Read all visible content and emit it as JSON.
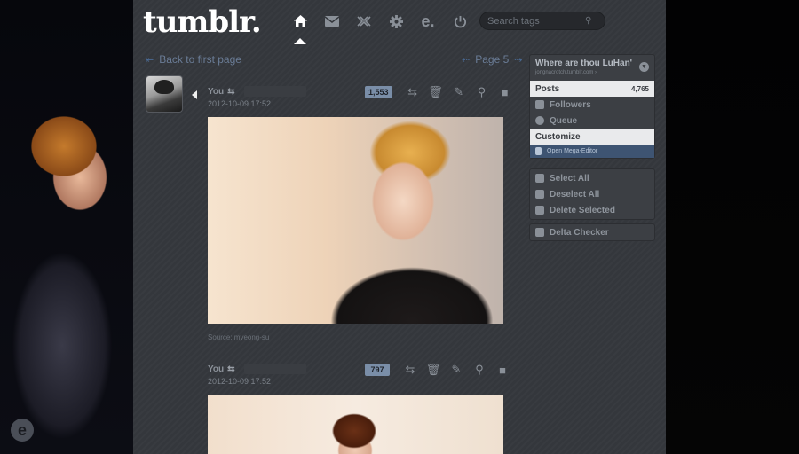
{
  "header": {
    "logo": "tumblr.",
    "nav": [
      {
        "name": "home-icon",
        "glyph": "⌂",
        "active": true
      },
      {
        "name": "mail-icon",
        "glyph": "✉",
        "active": false
      },
      {
        "name": "xkit-icon",
        "glyph": "✕",
        "active": false
      },
      {
        "name": "settings-icon",
        "glyph": "⚙",
        "active": false
      },
      {
        "name": "mega-editor-icon",
        "glyph": "e.",
        "active": false
      },
      {
        "name": "power-icon",
        "glyph": "⏻",
        "active": false
      }
    ],
    "search_placeholder": "Search tags"
  },
  "pagination": {
    "back_label": "Back to first page",
    "page_label": "Page 5"
  },
  "posts": [
    {
      "author": "You",
      "date": "2012-10-09 17:52",
      "notes": "1,553",
      "source": "Source: myeong-su"
    },
    {
      "author": "You",
      "date": "2012-10-09 17:52",
      "notes": "797"
    }
  ],
  "sidebar": {
    "blog_name": "Where are thou LuHan'",
    "blog_url": "jongnacrotch.tumblr.com ›",
    "items": [
      {
        "label": "Posts",
        "count": "4,765"
      },
      {
        "label": "Followers"
      },
      {
        "label": "Queue"
      },
      {
        "label": "Customize"
      },
      {
        "label": "Open Mega-Editor"
      }
    ],
    "selection": [
      {
        "label": "Select All"
      },
      {
        "label": "Deselect All"
      },
      {
        "label": "Delete Selected"
      }
    ],
    "delta": {
      "label": "Delta Checker"
    }
  },
  "colors": {
    "panel": "#34373c",
    "link": "#6a7c96",
    "notes_badge": "#7a8ea8",
    "mega_editor": "#3e5472"
  }
}
